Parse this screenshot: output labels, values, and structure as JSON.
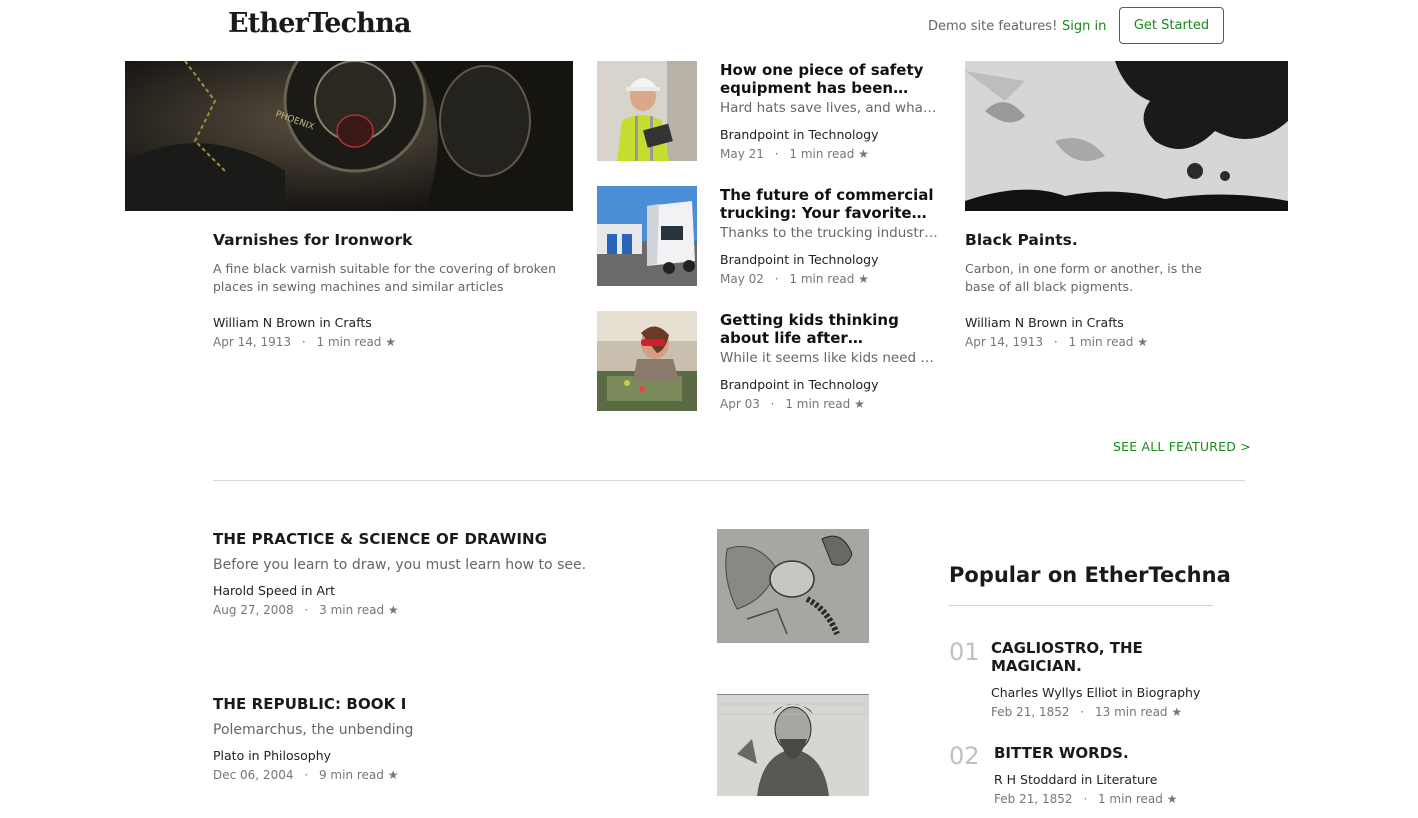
{
  "header": {
    "logo": "EtherTechna",
    "demo": "Demo site features!",
    "signin": "Sign in",
    "get_started": "Get Started"
  },
  "featured_left": {
    "title": "Varnishes for Ironwork",
    "desc": "A fine black varnish suitable for the covering of broken places in sewing machines and similar articles",
    "author": "William N Brown in Crafts",
    "date": "Apr 14, 1913",
    "read": "1 min read",
    "image": "sewing-machine-photo"
  },
  "featured_middle": [
    {
      "title": "How one piece of safety equipment has been saving lives",
      "desc": "Hard hats save lives, and what you should know",
      "author": "Brandpoint in Technology",
      "date": "May 21",
      "read": "1 min read",
      "image": "worker-hardhat-photo"
    },
    {
      "title": "The future of commercial trucking: Your favorite things",
      "desc": "Thanks to the trucking industry, goods arrive daily",
      "author": "Brandpoint in Technology",
      "date": "May 02",
      "read": "1 min read",
      "image": "truck-photo"
    },
    {
      "title": "Getting kids thinking about life after graduation",
      "desc": "While it seems like kids need not worry yet",
      "author": "Brandpoint in Technology",
      "date": "Apr 03",
      "read": "1 min read",
      "image": "kid-workshop-photo"
    }
  ],
  "featured_right": {
    "title": "Black Paints.",
    "desc": "Carbon, in one form or another, is the base of all black pigments.",
    "author": "William N Brown in Crafts",
    "date": "Apr 14, 1913",
    "read": "1 min read",
    "image": "peeling-paint-photo"
  },
  "see_all": "SEE ALL FEATURED >",
  "articles": [
    {
      "title": "THE PRACTICE & SCIENCE OF DRAWING",
      "desc": "Before you learn to draw, you must learn how to see.",
      "author": "Harold Speed in Art",
      "date": "Aug 27, 2008",
      "read": "3 min read",
      "image": "drawing-sketch-image"
    },
    {
      "title": "THE REPUBLIC: BOOK I",
      "desc": "Polemarchus, the unbending",
      "author": "Plato in Philosophy",
      "date": "Dec 06, 2004",
      "read": "9 min read",
      "image": "plato-engraving-image"
    }
  ],
  "popular": {
    "heading": "Popular on EtherTechna",
    "items": [
      {
        "num": "01",
        "title": "CAGLIOSTRO, THE MAGICIAN.",
        "author": "Charles Wyllys Elliot in Biography",
        "date": "Feb 21, 1852",
        "read": "13 min read"
      },
      {
        "num": "02",
        "title": "BITTER WORDS.",
        "author": "R H Stoddard in Literature",
        "date": "Feb 21, 1852",
        "read": "1 min read"
      }
    ]
  },
  "meta_separator": "·",
  "star_glyph": "★"
}
